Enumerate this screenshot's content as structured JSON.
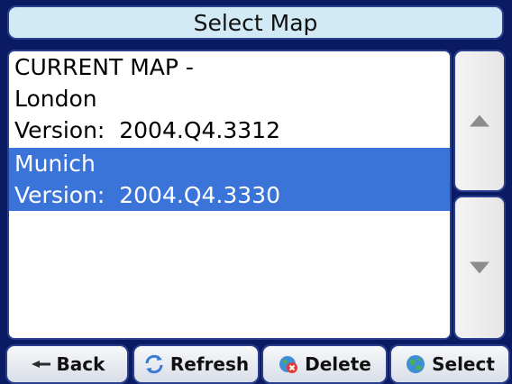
{
  "title": "Select Map",
  "maps": [
    {
      "lines": [
        "CURRENT MAP -",
        "London",
        "Version:  2004.Q4.3312"
      ],
      "selected": false
    },
    {
      "lines": [
        "Munich",
        "Version:  2004.Q4.3330"
      ],
      "selected": true
    }
  ],
  "toolbar": {
    "back_label": "Back",
    "refresh_label": "Refresh",
    "delete_label": "Delete",
    "select_label": "Select"
  },
  "icons": {
    "back": "back-arrow-icon",
    "refresh": "refresh-icon",
    "delete": "delete-globe-icon",
    "select": "globe-icon",
    "scroll_up": "triangle-up-icon",
    "scroll_down": "triangle-down-icon"
  },
  "colors": {
    "background": "#0b1b63",
    "title_bg": "#d2eaf6",
    "selection": "#3b74d8",
    "border": "#2a3f8d"
  }
}
